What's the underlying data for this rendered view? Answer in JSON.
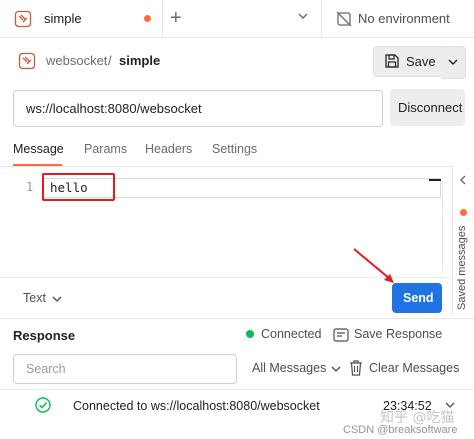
{
  "tab": {
    "title": "simple",
    "unsaved_color": "#ff6c37"
  },
  "environment": {
    "label": "No environment"
  },
  "breadcrumb": {
    "parent": "websocket",
    "separator": "/",
    "current": "simple"
  },
  "toolbar": {
    "save_label": "Save"
  },
  "request": {
    "url": "ws://localhost:8080/websocket",
    "disconnect_label": "Disconnect"
  },
  "subtabs": [
    {
      "label": "Message",
      "active": true
    },
    {
      "label": "Params"
    },
    {
      "label": "Headers"
    },
    {
      "label": "Settings"
    }
  ],
  "editor": {
    "line_number": "1",
    "content": "hello"
  },
  "rail": {
    "label": "Saved messages"
  },
  "message_format": {
    "label": "Text"
  },
  "send": {
    "label": "Send",
    "color": "#1f73e3"
  },
  "response": {
    "title": "Response",
    "status": "Connected",
    "status_color": "#0cbb52",
    "save_label": "Save Response",
    "search_placeholder": "Search",
    "filter_label": "All Messages",
    "clear_label": "Clear Messages",
    "messages": [
      {
        "text": "Connected to ws://localhost:8080/websocket",
        "time": "23:34:52"
      }
    ]
  },
  "watermark": {
    "zhihu": "知乎 @吃猫",
    "csdn": "CSDN @breaksoftware"
  }
}
